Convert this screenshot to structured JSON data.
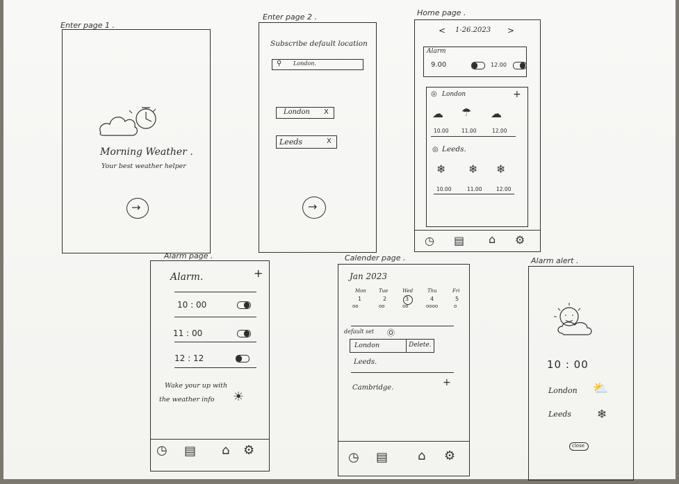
{
  "screens": {
    "enter1": {
      "label": "Enter page 1 .",
      "app_name": "Morning Weather .",
      "tagline": "Your best weather helper",
      "next_icon": "arrow-right-icon"
    },
    "enter2": {
      "label": "Enter page 2 .",
      "heading": "Subscribe default location",
      "search_value": "London.",
      "chips": [
        "London",
        "Leeds"
      ],
      "chip_remove": "X",
      "next_icon": "arrow-right-icon"
    },
    "home": {
      "label": "Home page .",
      "date": "1-26.2023",
      "prev": "<",
      "next": ">",
      "alarm_title": "Alarm",
      "alarms": [
        {
          "time": "9.00",
          "on": true
        },
        {
          "time": "12.00",
          "on": true
        }
      ],
      "locations": [
        {
          "name": "London",
          "icons": [
            "cloud-icon",
            "umbrella-icon",
            "cloudy-icon"
          ],
          "times": [
            "10.00",
            "11.00",
            "12.00"
          ]
        },
        {
          "name": "Leeds.",
          "icons": [
            "snowflake-icon",
            "snowflake-icon",
            "snowflake-icon"
          ],
          "times": [
            "10.00",
            "11.00",
            "12.00"
          ]
        }
      ],
      "add": "+"
    },
    "alarm": {
      "label": "Alarm page .",
      "title": "Alarm.",
      "add": "+",
      "items": [
        {
          "time": "10 : 00",
          "on": true
        },
        {
          "time": "11 : 00",
          "on": true
        },
        {
          "time": "12 : 12",
          "on": false
        }
      ],
      "note_line1": "Wake your up with",
      "note_line2": "the weather info"
    },
    "calendar": {
      "label": "Calender page .",
      "month": "Jan 2023",
      "days": [
        {
          "name": "Mon",
          "num": "1",
          "dots": "oo"
        },
        {
          "name": "Tue",
          "num": "2",
          "dots": "oo"
        },
        {
          "name": "Wed",
          "num": "3",
          "dots": "oo"
        },
        {
          "name": "Thu",
          "num": "4",
          "dots": "oooo"
        },
        {
          "name": "Fri",
          "num": "5",
          "dots": "o"
        }
      ],
      "default_set": "default set",
      "locations": [
        "London",
        "Leeds.",
        "Cambridge."
      ],
      "delete": "Delete.",
      "add": "+"
    },
    "alert": {
      "label": "Alarm alert .",
      "time": "10 : 00",
      "locations": [
        {
          "name": "London",
          "icon": "sun-cloud-icon"
        },
        {
          "name": "Leeds",
          "icon": "snowflake-icon"
        }
      ],
      "close": "close"
    }
  },
  "nav_icons": [
    "clock-icon",
    "calendar-icon",
    "home-icon",
    "gear-icon"
  ]
}
